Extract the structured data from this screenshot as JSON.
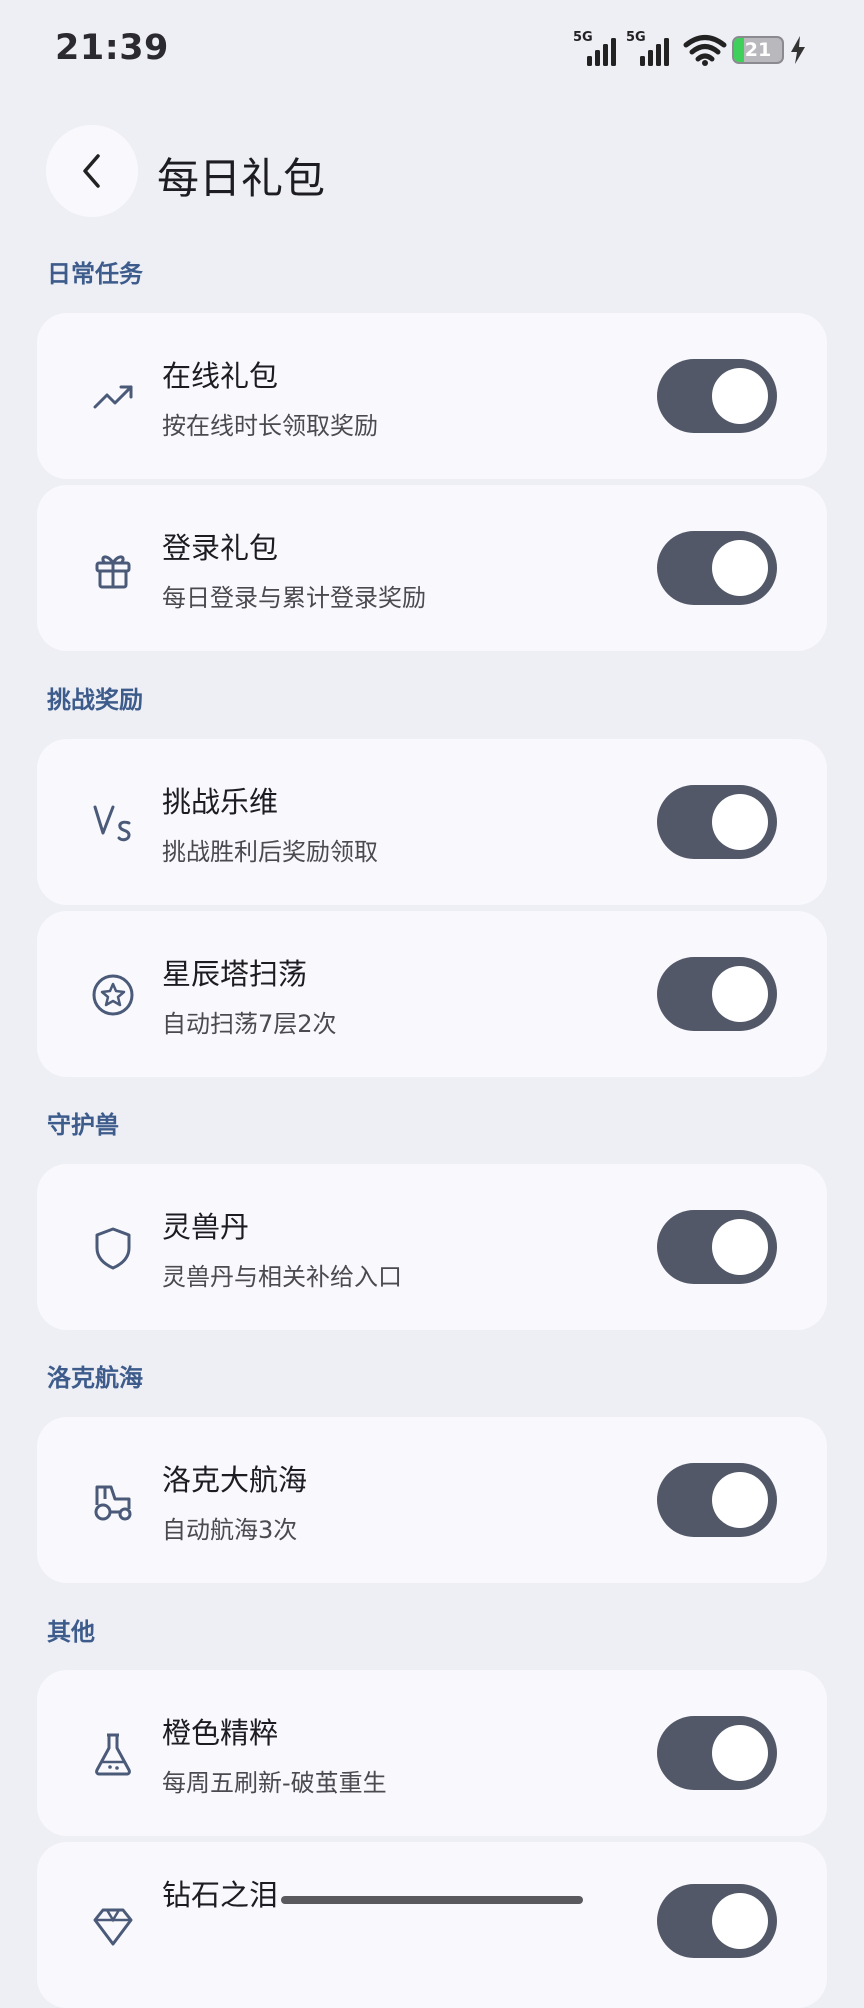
{
  "status": {
    "time": "21:39",
    "net1": "5G",
    "net2": "5G",
    "battery": "21",
    "battery_level": 0.21
  },
  "header": {
    "title": "每日礼包"
  },
  "sections": [
    {
      "label": "日常任务",
      "items": [
        {
          "title": "在线礼包",
          "subtitle": "按在线时长领取奖励",
          "icon": "trending-up-icon",
          "on": true
        },
        {
          "title": "登录礼包",
          "subtitle": "每日登录与累计登录奖励",
          "icon": "gift-icon",
          "on": true
        }
      ]
    },
    {
      "label": "挑战奖励",
      "items": [
        {
          "title": "挑战乐维",
          "subtitle": "挑战胜利后奖励领取",
          "icon": "versus-icon",
          "on": true
        },
        {
          "title": "星辰塔扫荡",
          "subtitle": "自动扫荡7层2次",
          "icon": "star-circle-icon",
          "on": true
        }
      ]
    },
    {
      "label": "守护兽",
      "items": [
        {
          "title": "灵兽丹",
          "subtitle": "灵兽丹与相关补给入口",
          "icon": "shield-icon",
          "on": true
        }
      ]
    },
    {
      "label": "洛克航海",
      "items": [
        {
          "title": "洛克大航海",
          "subtitle": "自动航海3次",
          "icon": "tractor-icon",
          "on": true
        }
      ]
    },
    {
      "label": "其他",
      "items": [
        {
          "title": "橙色精粹",
          "subtitle": "每周五刷新-破茧重生",
          "icon": "flask-icon",
          "on": true
        },
        {
          "title": "钻石之泪",
          "subtitle": "",
          "icon": "gem-icon",
          "on": true
        }
      ]
    }
  ]
}
